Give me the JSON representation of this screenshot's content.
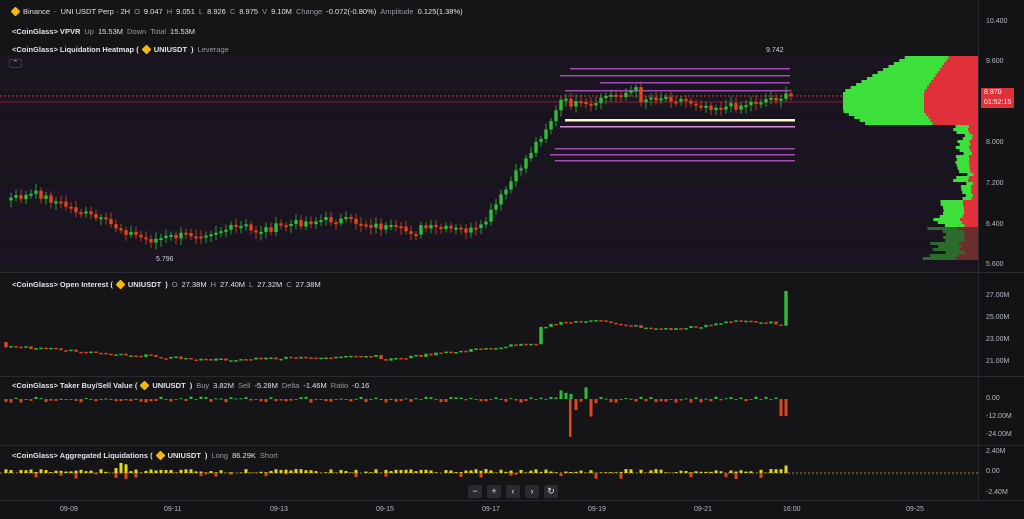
{
  "header": {
    "exchange": "Binance",
    "symbol": "UNI USDT Perp · 2H",
    "o_label": "O",
    "o": "9.047",
    "h_label": "H",
    "h": "9.051",
    "l_label": "L",
    "l": "8.926",
    "c_label": "C",
    "c": "8.975",
    "v_label": "V",
    "v": "9.10M",
    "change_label": "Change",
    "change": "-0.072(-0.80%)",
    "amp_label": "Amplitude",
    "amp": "0.125(1.38%)"
  },
  "vpvr": {
    "title": "<CoinGlass> VPVR",
    "up_label": "Up",
    "up": "15.53M",
    "down_label": "Down",
    "total_label": "Total",
    "total": "15.53M"
  },
  "heatmap": {
    "title": "<CoinGlass> Liquidation Heatmap (",
    "symbol": "UNIUSDT",
    "close_paren": ")",
    "extra": "Leverage"
  },
  "main_axis": [
    "10.400",
    "9.600",
    "8.000",
    "7.200",
    "6.400",
    "5.600"
  ],
  "price_tag": {
    "price": "8.970",
    "countdown": "01:52:15"
  },
  "annotations": {
    "high": "9.742",
    "low": "5.796"
  },
  "open_interest": {
    "title": "<CoinGlass> Open Interest (",
    "symbol": "UNIUSDT",
    "close_paren": ")",
    "o_label": "O",
    "o": "27.38M",
    "h_label": "H",
    "h": "27.40M",
    "l_label": "L",
    "l": "27.32M",
    "c_label": "C",
    "c": "27.38M",
    "axis": [
      "27.00M",
      "25.00M",
      "23.00M",
      "21.00M"
    ]
  },
  "taker": {
    "title": "<CoinGlass> Taker Buy/Sell Value (",
    "symbol": "UNIUSDT",
    "close_paren": ")",
    "buy_label": "Buy",
    "buy": "3.82M",
    "sell_label": "Sell",
    "sell": "-5.28M",
    "delta_label": "Delta",
    "delta": "-1.46M",
    "ratio_label": "Ratio",
    "ratio": "-0.16",
    "axis": [
      "0.00",
      "-12.00M",
      "-24.00M"
    ]
  },
  "liquidations": {
    "title": "<CoinGlass> Aggregated Liquidations (",
    "symbol": "UNIUSDT",
    "close_paren": ")",
    "long_label": "Long",
    "long": "86.29K",
    "short_label": "Short",
    "axis": [
      "2.40M",
      "0.00",
      "-2.40M"
    ]
  },
  "x_axis": [
    "09-09",
    "09-11",
    "09-13",
    "09-15",
    "09-17",
    "09-19",
    "09-21",
    "16:00",
    "09-25"
  ],
  "nav": {
    "zoom_out": "−",
    "zoom_in": "+",
    "prev": "‹",
    "next": "›",
    "reset": "↻"
  },
  "colors": {
    "up": "#2fbd3a",
    "down": "#e0451b",
    "bg": "#131315",
    "accent": "#f0b90b",
    "price_line": "#e0303a"
  }
}
